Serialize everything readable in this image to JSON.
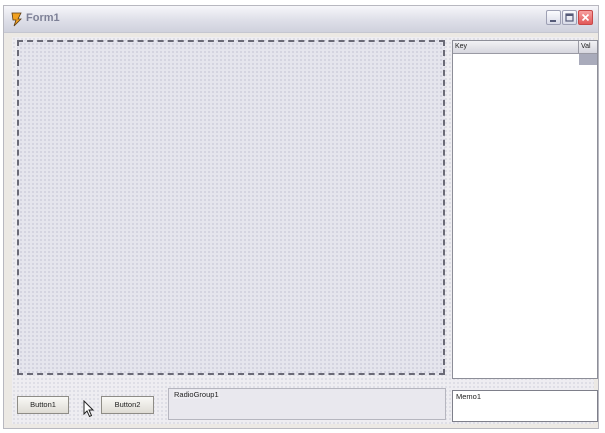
{
  "window": {
    "title": "Form1"
  },
  "grid": {
    "columns": [
      "Key",
      "Val"
    ]
  },
  "buttons": {
    "button1": "Button1",
    "button2": "Button2"
  },
  "radiogroup": {
    "caption": "RadioGroup1"
  },
  "memo": {
    "text": "Memo1"
  },
  "icons": {
    "app": "delphi-app-icon",
    "minimize": "minimize-icon",
    "maximize": "maximize-icon",
    "close": "close-icon",
    "cursor": "mouse-pointer-icon"
  },
  "colors": {
    "close_button": "#e25858",
    "client": "#eeedf1"
  }
}
